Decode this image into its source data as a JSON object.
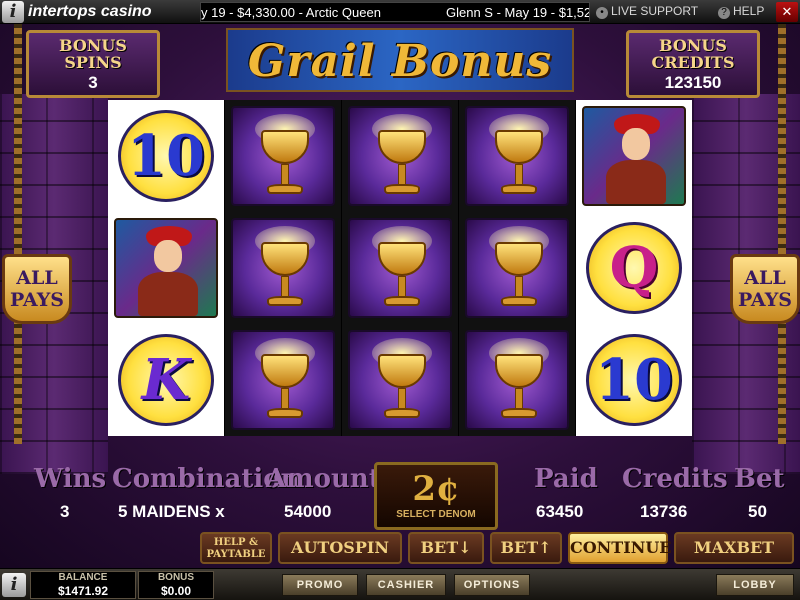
{
  "app": {
    "brand": "intertops casino",
    "logo_letter": "i",
    "ticker": [
      "y 19 - $4,330.00 - Arctic Queen",
      "Glenn S - May 19 - $1,52"
    ],
    "live_support": "LIVE SUPPORT",
    "help": "HELP",
    "close": "✕"
  },
  "game": {
    "title": "Grail Bonus",
    "bonus_spins_label": "BONUS SPINS",
    "bonus_spins": "3",
    "bonus_credits_label": "BONUS CREDITS",
    "bonus_credits": "123150",
    "all_pays": "ALL PAYS",
    "reels": [
      [
        "10",
        "maiden",
        "K"
      ],
      [
        "grail",
        "grail",
        "grail"
      ],
      [
        "grail",
        "grail",
        "grail"
      ],
      [
        "grail",
        "grail",
        "grail"
      ],
      [
        "maiden",
        "Q",
        "10"
      ]
    ]
  },
  "info": {
    "wins_label": "Wins",
    "wins": "3",
    "combination_label": "Combination",
    "combination": "5 MAIDENS x",
    "amount_label": "Amount",
    "amount": "54000",
    "denom": "2¢",
    "denom_label": "SELECT DENOM",
    "paid_label": "Paid",
    "paid": "63450",
    "credits_label": "Credits",
    "credits": "13736",
    "bet_label": "Bet",
    "bet": "50"
  },
  "buttons": {
    "help": "HELP & PAYTABLE",
    "autospin": "AUTOSPIN",
    "bet_down": "BET↓",
    "bet_up": "BET↑",
    "continue": "CONTINUE",
    "maxbet": "MAXBET"
  },
  "footer": {
    "balance_label": "BALANCE",
    "balance": "$1471.92",
    "bonus_label": "BONUS",
    "bonus": "$0.00",
    "promo": "PROMO",
    "cashier": "CASHIER",
    "options": "OPTIONS",
    "lobby": "LOBBY"
  }
}
